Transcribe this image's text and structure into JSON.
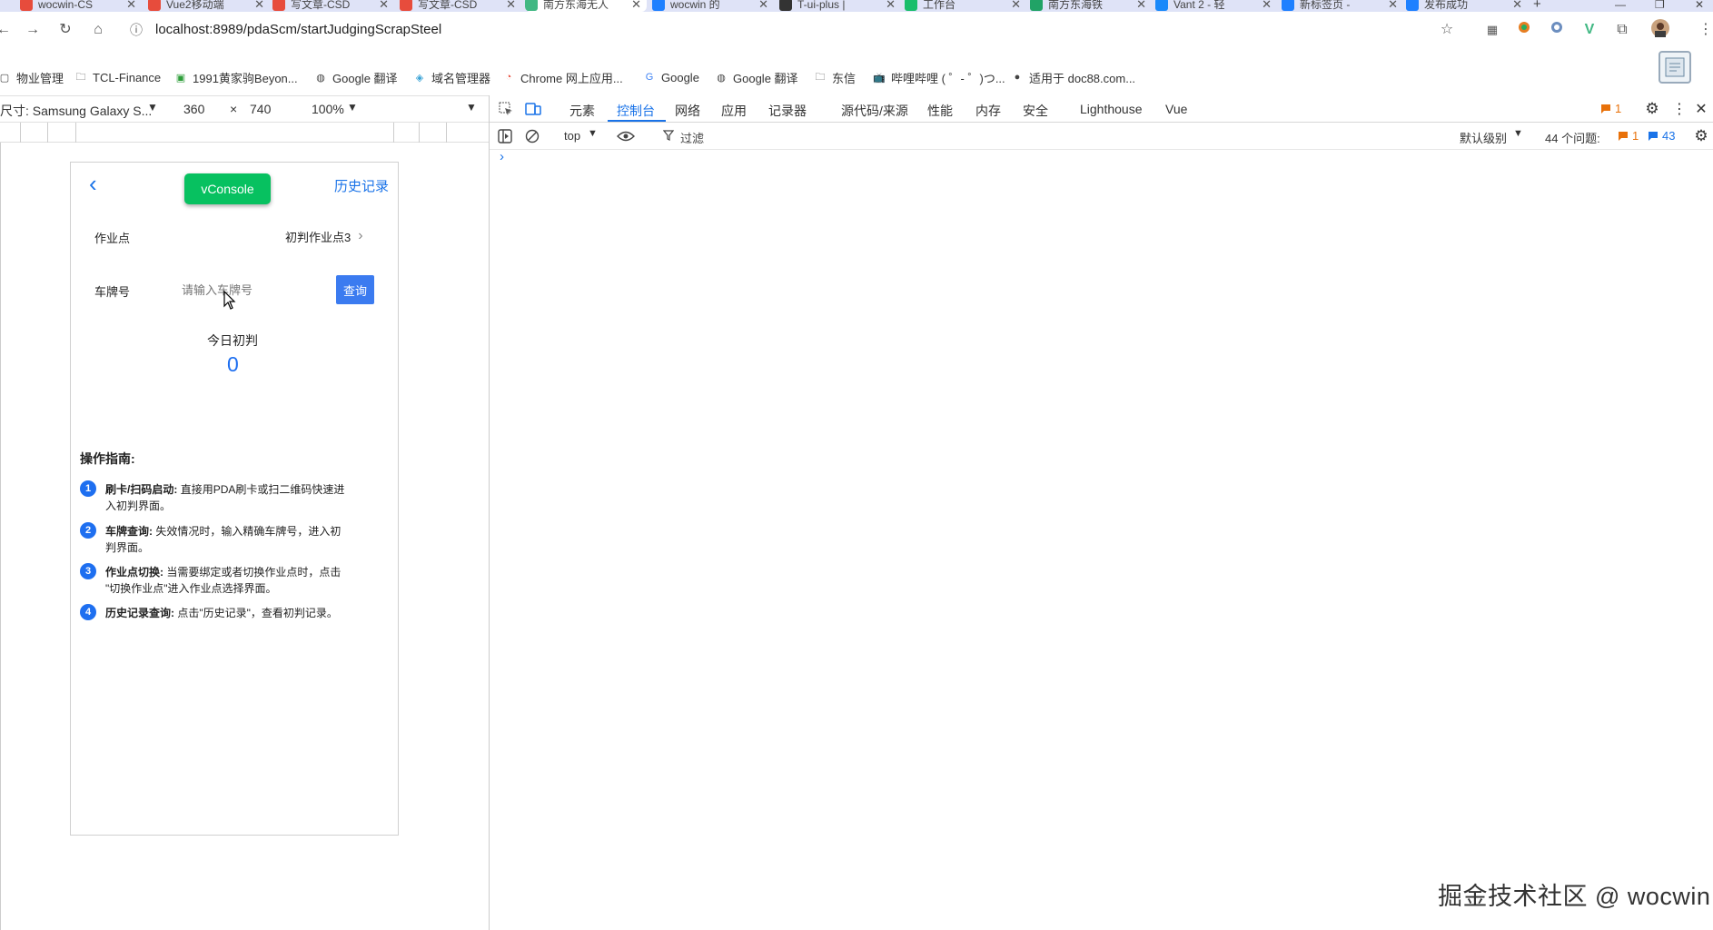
{
  "browser": {
    "tabs": [
      {
        "title": "wocwin-CS",
        "icon": "csdn-icon",
        "color": "#e74c3c"
      },
      {
        "title": "Vue2移动端",
        "icon": "csdn-icon",
        "color": "#e74c3c"
      },
      {
        "title": "写文章-CSD",
        "icon": "csdn-icon",
        "color": "#e74c3c"
      },
      {
        "title": "写文章-CSD",
        "icon": "csdn-icon",
        "color": "#e74c3c"
      },
      {
        "title": "南方东海无人",
        "icon": "vue-icon",
        "color": "#41b883"
      },
      {
        "title": "wocwin 的",
        "icon": "juejin-icon",
        "color": "#1e80ff"
      },
      {
        "title": "T-ui-plus |",
        "icon": "github-icon",
        "color": "#333333"
      },
      {
        "title": "工作台",
        "icon": "workbench-icon",
        "color": "#19be6b"
      },
      {
        "title": "南方东海铁",
        "icon": "sheet-icon",
        "color": "#21a366"
      },
      {
        "title": "Vant 2 - 轻",
        "icon": "vant-icon",
        "color": "#1989fa"
      },
      {
        "title": "新标签页 - ",
        "icon": "juejin-icon",
        "color": "#1e80ff"
      },
      {
        "title": "发布成功",
        "icon": "juejin-icon",
        "color": "#1e80ff"
      }
    ],
    "new_tab": "+",
    "url": "localhost:8989/pdaScm/startJudgingScrapSteel"
  },
  "bookmarks": [
    {
      "label": "物业管理",
      "icon": "page-icon"
    },
    {
      "label": "TCL-Finance",
      "icon": "folder-icon"
    },
    {
      "label": "1991黄家驹Beyon...",
      "icon": "bookmark-icon"
    },
    {
      "label": "Google 翻译",
      "icon": "globe-icon"
    },
    {
      "label": "域名管理器",
      "icon": "shield-icon"
    },
    {
      "label": "Chrome 网上应用...",
      "icon": "chrome-icon"
    },
    {
      "label": "Google",
      "icon": "google-icon"
    },
    {
      "label": "Google 翻译",
      "icon": "globe-icon"
    },
    {
      "label": "东信",
      "icon": "folder-icon"
    },
    {
      "label": "哔哩哔哩 ( ゜- ゜)つ...",
      "icon": "bilibili-icon"
    },
    {
      "label": "适用于 doc88.com...",
      "icon": "doc88-icon"
    }
  ],
  "device_toolbar": {
    "device": "尺寸: Samsung Galaxy S...",
    "width": "360",
    "times": "×",
    "height": "740",
    "zoom": "100%"
  },
  "phone": {
    "back": "‹",
    "vconsole": "vConsole",
    "history": "历史记录",
    "workpoint_label": "作业点",
    "workpoint_value": "初判作业点3",
    "plate_label": "车牌号",
    "plate_placeholder": "请输入车牌号",
    "query_button": "查询",
    "today_label": "今日初判",
    "today_count": "0",
    "guide_title": "操作指南:",
    "guide": [
      {
        "num": "1",
        "bold": "刷卡/扫码启动:",
        "line1": "直接用PDA刷卡或扫二维码快速进",
        "line2": "入初判界面。"
      },
      {
        "num": "2",
        "bold": "车牌查询:",
        "line1": "失效情况时，输入精确车牌号，进入初",
        "line2": "判界面。"
      },
      {
        "num": "3",
        "bold": "作业点切换:",
        "line1": "当需要绑定或者切换作业点时，点击",
        "line2": "\"切换作业点\"进入作业点选择界面。"
      },
      {
        "num": "4",
        "bold": "历史记录查询:",
        "line1": "点击\"历史记录\"，查看初判记录。",
        "line2": ""
      }
    ]
  },
  "devtools": {
    "tabs": [
      "元素",
      "控制台",
      "网络",
      "应用",
      "记录器",
      "源代码/来源",
      "性能",
      "内存",
      "安全",
      "Lighthouse",
      "Vue"
    ],
    "active_tab": "控制台",
    "error_count": "1",
    "console_bar": {
      "context": "top",
      "filter": "过滤",
      "level": "默认级别",
      "issues_label": "44 个问题:",
      "issues_errors": "1",
      "issues_info": "43"
    },
    "prompt": "›"
  },
  "watermark": "掘金技术社区 @ wocwin",
  "colors": {
    "tab_strip": "#dfe3f7",
    "accent_blue": "#1a73e8",
    "vconsole_green": "#07c160",
    "query_blue": "#3b7bf0",
    "guide_blue": "#1e6ff0"
  }
}
